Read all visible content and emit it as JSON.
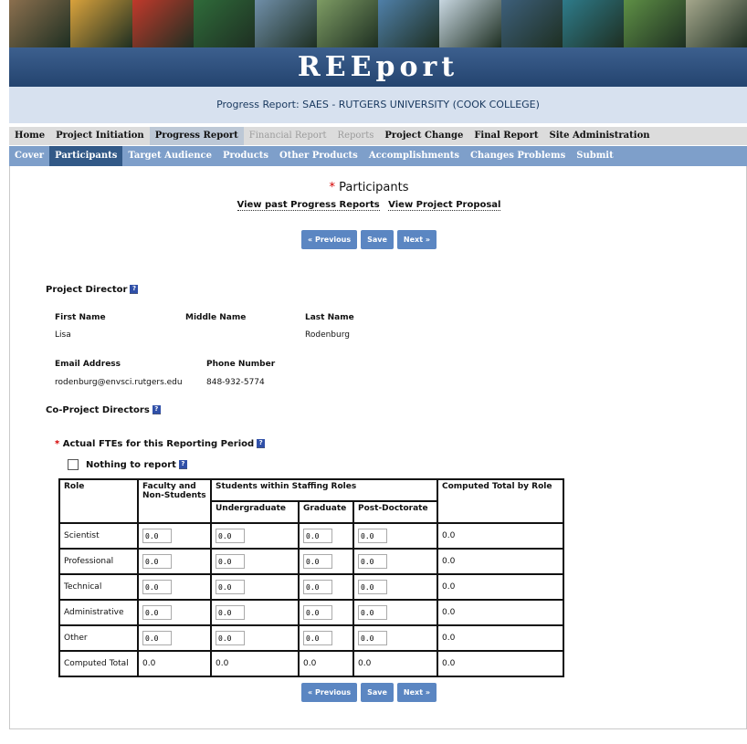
{
  "app": {
    "brand": "REEport",
    "subtitle": "Progress Report: SAES - RUTGERS UNIVERSITY (COOK COLLEGE)"
  },
  "banner_colors": [
    "#8b6f4e",
    "#d9a23c",
    "#c0392b",
    "#2f6b3a",
    "#6f8ea8",
    "#7d9b63",
    "#4f7fa8",
    "#c7d6e0",
    "#3d5f7a",
    "#2e7b8a",
    "#5e8f45",
    "#a5a78c"
  ],
  "nav": {
    "main": [
      {
        "label": "Home",
        "state": "normal"
      },
      {
        "label": "Project Initiation",
        "state": "normal"
      },
      {
        "label": "Progress Report",
        "state": "active"
      },
      {
        "label": "Financial Report",
        "state": "disabled"
      },
      {
        "label": "Reports",
        "state": "disabled"
      },
      {
        "label": "Project Change",
        "state": "normal"
      },
      {
        "label": "Final Report",
        "state": "normal"
      },
      {
        "label": "Site Administration",
        "state": "normal"
      }
    ],
    "sub": [
      {
        "label": "Cover",
        "state": "normal"
      },
      {
        "label": "Participants",
        "state": "active"
      },
      {
        "label": "Target Audience",
        "state": "normal"
      },
      {
        "label": "Products",
        "state": "normal"
      },
      {
        "label": "Other Products",
        "state": "normal"
      },
      {
        "label": "Accomplishments",
        "state": "normal"
      },
      {
        "label": "Changes Problems",
        "state": "normal"
      },
      {
        "label": "Submit",
        "state": "normal"
      }
    ]
  },
  "page": {
    "required_mark": "*",
    "title": "Participants",
    "link_past": "View past Progress Reports",
    "link_proposal": "View Project Proposal",
    "btn_prev": "« Previous",
    "btn_save": "Save",
    "btn_next": "Next »",
    "help_glyph": "?"
  },
  "director": {
    "heading": "Project Director",
    "first_name_label": "First Name",
    "middle_name_label": "Middle Name",
    "last_name_label": "Last Name",
    "first_name": "Lisa",
    "middle_name": "",
    "last_name": "Rodenburg",
    "email_label": "Email Address",
    "phone_label": "Phone Number",
    "email": "rodenburg@envsci.rutgers.edu",
    "phone": "848-932-5774"
  },
  "co_directors": {
    "heading": "Co-Project Directors"
  },
  "fte": {
    "heading": "Actual FTEs for this Reporting Period",
    "nothing_label": "Nothing to report",
    "headers": {
      "role": "Role",
      "faculty": "Faculty and Non-Students",
      "students": "Students within Staffing Roles",
      "undergrad": "Undergraduate",
      "graduate": "Graduate",
      "postdoc": "Post-Doctorate",
      "computed": "Computed Total by Role"
    },
    "rows": [
      {
        "role": "Scientist",
        "faculty": "0.0",
        "undergrad": "0.0",
        "graduate": "0.0",
        "postdoc": "0.0",
        "total": "0.0"
      },
      {
        "role": "Professional",
        "faculty": "0.0",
        "undergrad": "0.0",
        "graduate": "0.0",
        "postdoc": "0.0",
        "total": "0.0"
      },
      {
        "role": "Technical",
        "faculty": "0.0",
        "undergrad": "0.0",
        "graduate": "0.0",
        "postdoc": "0.0",
        "total": "0.0"
      },
      {
        "role": "Administrative",
        "faculty": "0.0",
        "undergrad": "0.0",
        "graduate": "0.0",
        "postdoc": "0.0",
        "total": "0.0"
      },
      {
        "role": "Other",
        "faculty": "0.0",
        "undergrad": "0.0",
        "graduate": "0.0",
        "postdoc": "0.0",
        "total": "0.0"
      }
    ],
    "total_row": {
      "role": "Computed Total",
      "faculty": "0.0",
      "undergrad": "0.0",
      "graduate": "0.0",
      "postdoc": "0.0",
      "total": "0.0"
    }
  }
}
